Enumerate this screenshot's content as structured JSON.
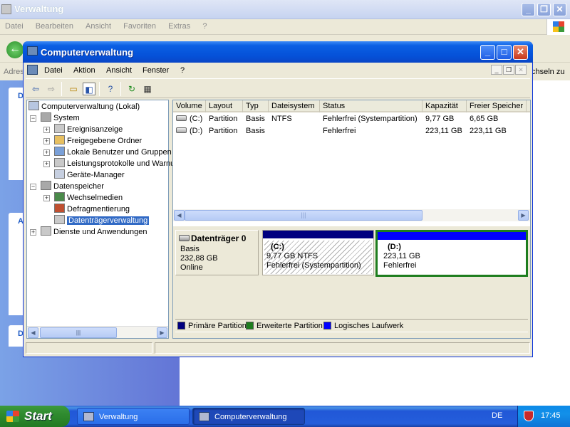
{
  "bg_window": {
    "title": "Verwaltung",
    "menu": [
      "Datei",
      "Bearbeiten",
      "Ansicht",
      "Favoriten",
      "Extras",
      "?"
    ],
    "address_label": "Adres",
    "switch_label": "chseln zu",
    "left_panel_letters": [
      "D",
      "A",
      "D"
    ]
  },
  "main_window": {
    "title": "Computerverwaltung",
    "menu": [
      "Datei",
      "Aktion",
      "Ansicht",
      "Fenster",
      "?"
    ],
    "tree": [
      {
        "label": "Computerverwaltung (Lokal)"
      },
      {
        "label": "System"
      },
      {
        "label": "Ereignisanzeige"
      },
      {
        "label": "Freigegebene Ordner"
      },
      {
        "label": "Lokale Benutzer und Gruppen"
      },
      {
        "label": "Leistungsprotokolle und Warnungen"
      },
      {
        "label": "Geräte-Manager"
      },
      {
        "label": "Datenspeicher"
      },
      {
        "label": "Wechselmedien"
      },
      {
        "label": "Defragmentierung"
      },
      {
        "label": "Datenträgerverwaltung"
      },
      {
        "label": "Dienste und Anwendungen"
      }
    ],
    "columns": [
      "Volume",
      "Layout",
      "Typ",
      "Dateisystem",
      "Status",
      "Kapazität",
      "Freier Speicher"
    ],
    "volumes": [
      [
        "(C:)",
        "Partition",
        "Basis",
        "NTFS",
        "Fehlerfrei (Systempartition)",
        "9,77 GB",
        "6,65 GB"
      ],
      [
        "(D:)",
        "Partition",
        "Basis",
        "",
        "Fehlerfrei",
        "223,11 GB",
        "223,11 GB"
      ]
    ],
    "disk": {
      "name": "Datenträger 0",
      "type": "Basis",
      "size": "232,88 GB",
      "status": "Online"
    },
    "partitions": [
      {
        "label": "(C:)",
        "size": "9,77 GB NTFS",
        "status": "Fehlerfrei (Systempartition)",
        "color": "#00007f"
      },
      {
        "label": "(D:)",
        "size": "223,11 GB",
        "status": "Fehlerfrei",
        "color": "#0000ff"
      }
    ],
    "legend": [
      {
        "label": "Primäre Partition",
        "color": "#00007f"
      },
      {
        "label": "Erweiterte Partition",
        "color": "#1e7d1e"
      },
      {
        "label": "Logisches Laufwerk",
        "color": "#0000ff"
      }
    ]
  },
  "taskbar": {
    "start": "Start",
    "tasks": [
      "Verwaltung",
      "Computerverwaltung"
    ],
    "language": "DE",
    "time": "17:45"
  }
}
